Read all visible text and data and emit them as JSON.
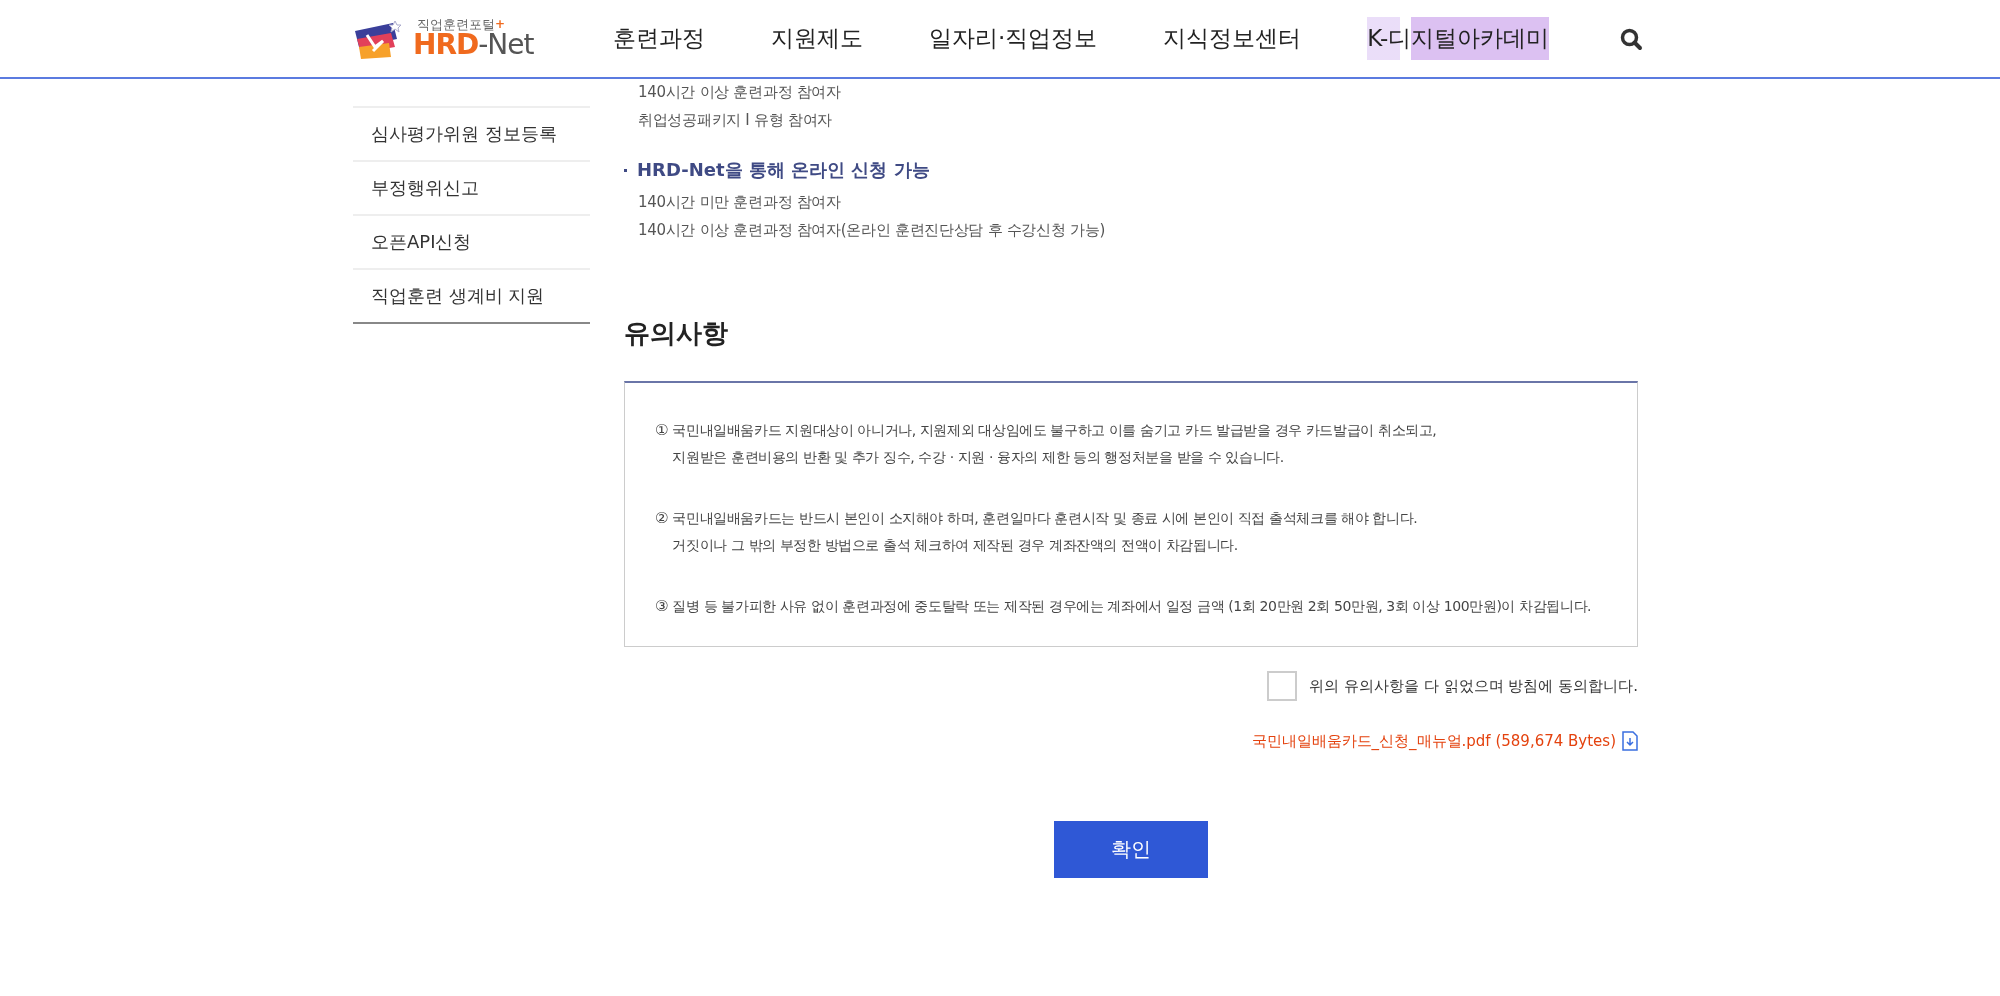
{
  "header": {
    "logo": {
      "tagline": "직업훈련포털",
      "mark": "+",
      "brand_primary": "HRD",
      "brand_secondary": "-Net"
    },
    "nav": [
      {
        "label": "훈련과정",
        "highlighted": false
      },
      {
        "label": "지원제도",
        "highlighted": false
      },
      {
        "label": "일자리·직업정보",
        "highlighted": false
      },
      {
        "label": "지식정보센터",
        "highlighted": false
      },
      {
        "label": "K-디지털아카데미",
        "highlighted": true
      }
    ]
  },
  "sidebar": {
    "items": [
      {
        "label": "심사평가위원 정보등록",
        "selected": false
      },
      {
        "label": "부정행위신고",
        "selected": false
      },
      {
        "label": "오픈API신청",
        "selected": false
      },
      {
        "label": "직업훈련 생계비 지원",
        "selected": false
      }
    ]
  },
  "eligibility": [
    {
      "lines": [
        "140시간 이상 훈련과정 참여자",
        "취업성공패키지  I 유형 참여자"
      ]
    },
    {
      "heading": "HRD-Net을 통해 온라인 신청 가능",
      "lines": [
        "140시간 미만 훈련과정 참여자",
        "140시간 이상 훈련과정 참여자(온라인 훈련진단상담 후 수강신청 가능)"
      ]
    }
  ],
  "notice": {
    "title": "유의사항",
    "items": [
      {
        "number": "①",
        "lines": [
          "국민내일배움카드 지원대상이 아니거나, 지원제외 대상임에도 불구하고 이를 숨기고 카드 발급받을 경우 카드발급이 취소되고,",
          "지원받은 훈련비용의 반환 및 추가 징수, 수강 · 지원 · 융자의 제한 등의 행정처분을 받을 수 있습니다."
        ]
      },
      {
        "number": "②",
        "lines": [
          "국민내일배움카드는 반드시 본인이 소지해야 하며, 훈련일마다 훈련시작 및 종료 시에 본인이 직접 출석체크를 해야 합니다.",
          "거짓이나 그 밖의 부정한 방법으로 출석 체크하여 제작된 경우 계좌잔액의 전액이 차감됩니다."
        ]
      },
      {
        "number": "③",
        "lines": [
          "질병 등 불가피한 사유 없이 훈련과정에 중도탈락 또는 제작된 경우에는 계좌에서 일정 금액 (1회 20만원 2회 50만원, 3회 이상 100만원)이 차감됩니다."
        ]
      }
    ]
  },
  "agreement": {
    "label": "위의 유의사항을 다 읽었으며 방침에 동의합니다.",
    "checked": false
  },
  "download": {
    "label": "국민내일배움카드_신청_매뉴얼.pdf (589,674 Bytes)"
  },
  "confirm_button": "확인"
}
